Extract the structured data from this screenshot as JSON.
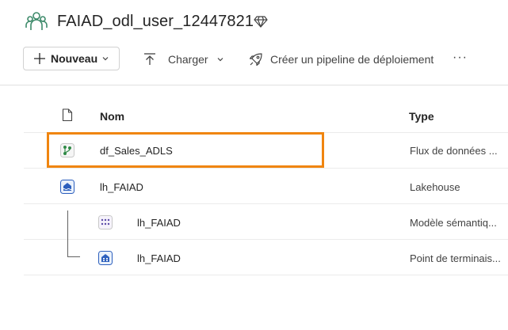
{
  "workspace": {
    "name": "FAIAD_odl_user_12447821",
    "icon": "workspace-people-icon",
    "badge_icon": "diamond-icon"
  },
  "toolbar": {
    "new_label": "Nouveau",
    "upload_label": "Charger",
    "pipeline_label": "Créer un pipeline de déploiement",
    "more_label": "···"
  },
  "table": {
    "columns": {
      "name": "Nom",
      "type": "Type"
    },
    "rows": [
      {
        "name": "df_Sales_ADLS",
        "type": "Flux de données ...",
        "icon": "dataflow-icon",
        "highlighted": true
      },
      {
        "name": "lh_FAIAD",
        "type": "Lakehouse",
        "icon": "lakehouse-icon"
      },
      {
        "name": "lh_FAIAD",
        "type": "Modèle sémantiq...",
        "icon": "semantic-model-icon",
        "child": true
      },
      {
        "name": "lh_FAIAD",
        "type": "Point de terminais...",
        "icon": "sql-endpoint-icon",
        "child": true
      }
    ]
  },
  "colors": {
    "highlight": "#f0850f",
    "accent_green": "#3a7d44",
    "accent_blue": "#2c5fbd"
  }
}
